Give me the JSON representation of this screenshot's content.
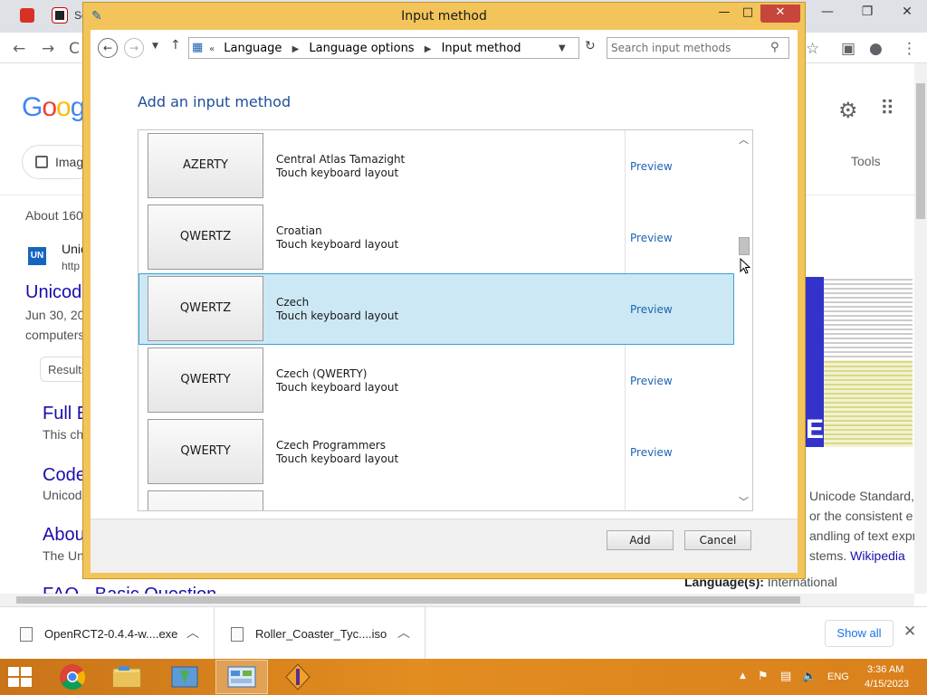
{
  "browser": {
    "tab_text": "Se",
    "search": {
      "images_chip": "Imag",
      "tools_label": "Tools",
      "results_count": "About 160",
      "result_site": "Unic",
      "result_url": "http",
      "result_title": "Unicod",
      "result_date": "Jun 30, 20",
      "result_snippet": "computers",
      "results_chip": "Results",
      "links": [
        {
          "title": "Full E",
          "snippet": "This ch"
        },
        {
          "title": "Code",
          "snippet": "Unicod"
        },
        {
          "title": "Abou",
          "snippet": "The Uni"
        },
        {
          "title": "FAQ - Basic Question"
        }
      ],
      "wiki": {
        "lines": [
          "Unicode Standard,",
          "or the consistent e",
          "andling of text expr"
        ],
        "line4_prefix": "stems. ",
        "line4_link": "Wikipedia",
        "language_label": "Language(s):",
        "language_value": " International"
      }
    }
  },
  "downloads": {
    "items": [
      {
        "name": "OpenRCT2-0.4.4-w....exe"
      },
      {
        "name": "Roller_Coaster_Tyc....iso"
      }
    ],
    "show_all": "Show all"
  },
  "taskbar": {
    "language": "ENG",
    "time": "3:36 AM",
    "date": "4/15/2023"
  },
  "dialog": {
    "title": "Input method",
    "breadcrumbs": [
      "Language",
      "Language options",
      "Input method"
    ],
    "breadcrumb_overflow": "«",
    "search_placeholder": "Search input methods",
    "heading": "Add an input method",
    "rows": [
      {
        "layout": "AZERTY",
        "name": "Central Atlas Tamazight",
        "desc": "Touch keyboard layout",
        "preview": "Preview",
        "selected": false
      },
      {
        "layout": "QWERTZ",
        "name": "Croatian",
        "desc": "Touch keyboard layout",
        "preview": "Preview",
        "selected": false
      },
      {
        "layout": "QWERTZ",
        "name": "Czech",
        "desc": "Touch keyboard layout",
        "preview": "Preview",
        "selected": true
      },
      {
        "layout": "QWERTY",
        "name": "Czech (QWERTY)",
        "desc": "Touch keyboard layout",
        "preview": "Preview",
        "selected": false
      },
      {
        "layout": "QWERTY",
        "name": "Czech Programmers",
        "desc": "Touch keyboard layout",
        "preview": "Preview",
        "selected": false
      }
    ],
    "buttons": {
      "add": "Add",
      "cancel": "Cancel"
    }
  },
  "colors": {
    "dialog_frame": "#f2c45a",
    "selection_fill": "#cce8f4",
    "selection_border": "#3c9fd6",
    "link_blue": "#1e64b4",
    "taskbar": "#e28d20"
  },
  "icons": [
    "back-arrow-icon",
    "forward-arrow-icon",
    "up-arrow-icon",
    "refresh-icon",
    "search-icon",
    "minimize-icon",
    "maximize-icon",
    "close-icon",
    "gear-icon",
    "apps-grid-icon",
    "windows-logo-icon",
    "chrome-icon",
    "file-explorer-icon",
    "flag-icon",
    "network-icon",
    "volume-muted-icon"
  ]
}
